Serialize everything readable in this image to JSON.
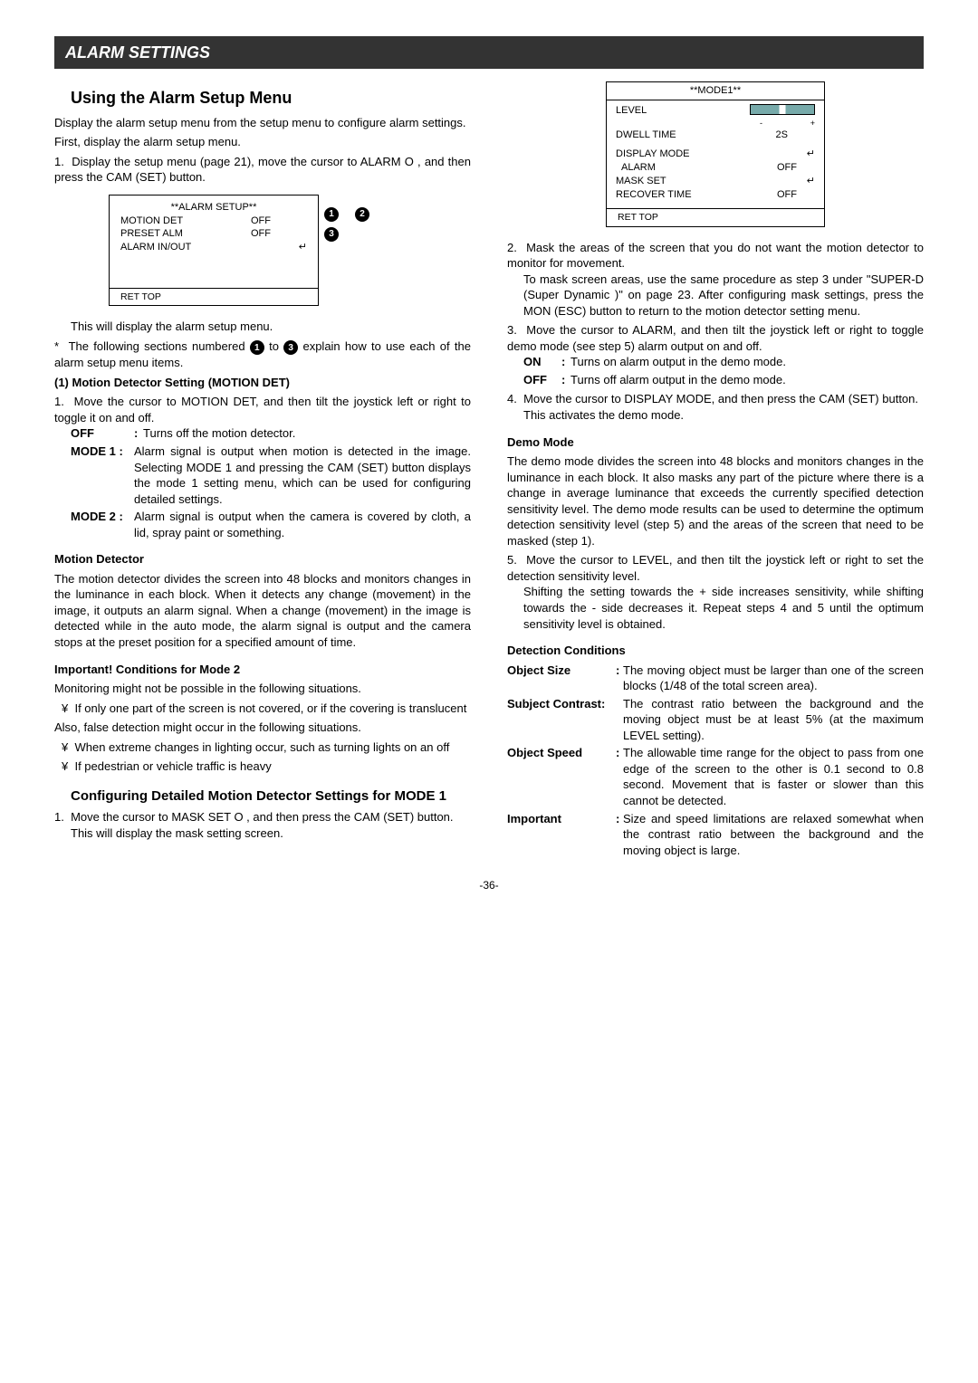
{
  "titleBar": "ALARM SETTINGS",
  "leftCol": {
    "h2": "Using the Alarm Setup Menu",
    "intro1": "Display the alarm setup menu from the setup menu to configure alarm settings.",
    "intro2": "First, display the alarm setup menu.",
    "step1": "Display the setup menu (page 21), move the cursor to ALARM O , and then press the CAM (SET) button.",
    "osd1": {
      "title": "**ALARM SETUP**",
      "r1a": "MOTION DET",
      "r1b": "OFF",
      "r2a": "PRESET ALM",
      "r2b": "OFF",
      "r3a": "ALARM IN/OUT",
      "arrow": "↵",
      "footer": "RET TOP"
    },
    "afterOsd1": "This will display the alarm setup menu.",
    "note": "The following sections numbered",
    "noteTo": "to",
    "noteEnd": "explain how to use each of the alarm setup menu items.",
    "h_section1": "(1)  Motion Detector Setting (MOTION DET)",
    "md_step1": "Move the cursor to MOTION DET, and then tilt the joystick left or right to toggle it on and off.",
    "off_label": "OFF",
    "off_colon": ":",
    "off_body": "Turns off the motion detector.",
    "mode1_label": "MODE 1 :",
    "mode1_body": "Alarm signal is output when motion is detected in the image. Selecting MODE 1 and pressing the CAM (SET) button displays the mode 1 setting menu, which can be used for configuring detailed settings.",
    "mode2_label": "MODE 2 :",
    "mode2_body": "Alarm signal is output when the camera is covered by cloth, a lid, spray paint or something.",
    "h_md": "Motion Detector",
    "md_body": "The motion detector divides the screen into 48 blocks and monitors changes in the luminance in each block. When it detects any change (movement) in the image, it outputs an alarm signal. When a change (movement) in the image is detected while in the auto mode, the alarm signal is output and the camera stops at the preset position for a specified amount of time.",
    "h_imp2": "Important! Conditions for Mode 2",
    "imp2_intro": "Monitoring might not be possible in the following situations.",
    "imp2_b1": "If only one part of the screen is not covered, or if the covering is translucent",
    "imp2_mid": "Also, false detection might occur in the following situations.",
    "imp2_b2": "When extreme changes in lighting occur, such as turning lights on an off",
    "imp2_b3": "If pedestrian or vehicle traffic is heavy",
    "h_conf": "Configuring Detailed Motion Detector Settings for MODE 1",
    "conf_step1a": "Move the cursor to MASK SET O , and then press the CAM (SET) button.",
    "conf_step1b": "This will display the mask setting screen."
  },
  "rightCol": {
    "osd2": {
      "title": "**MODE1**",
      "r1a": "LEVEL",
      "r_minus": "-",
      "r_plus": "+",
      "r2a": "DWELL TIME",
      "r2b": "2S",
      "r3a": "DISPLAY MODE",
      "arrow": "↵",
      "r4a": "ALARM",
      "r4b": "OFF",
      "r5a": "MASK SET",
      "arrow2": "↵",
      "r6a": "RECOVER TIME",
      "r6b": "OFF",
      "footer": "RET TOP"
    },
    "step2": "Mask the areas of the screen that you do not want the motion detector to monitor for movement.",
    "step2b": "To mask screen areas, use the same procedure as step 3 under \"SUPER-D    (Super Dynamic    )\" on page 23. After configuring mask settings, press the MON (ESC) button to return to the motion detector setting menu.",
    "step3": "Move the cursor to ALARM, and then tilt the joystick left or right to toggle demo mode (see step 5) alarm output on and off.",
    "on_label": "ON",
    "on_body": "Turns on alarm output in the demo mode.",
    "off_label": "OFF",
    "off_body": "Turns off alarm output in the demo mode.",
    "step4": "Move the cursor to DISPLAY MODE, and then press the CAM (SET) button.",
    "step4b": "This activates the demo mode.",
    "h_demo": "Demo Mode",
    "demo_body": "The demo mode divides the screen into 48 blocks and monitors changes in the luminance in each block. It also masks any part of the picture where there is a change in average luminance that exceeds the currently specified detection sensitivity level. The demo mode results can be used to determine the optimum detection sensitivity level (step 5) and the areas of the screen that need to be masked (step 1).",
    "step5": "Move the cursor to LEVEL, and then tilt the joystick left or right to set the detection sensitivity level.",
    "step5b": "Shifting the setting towards the + side increases sensitivity, while shifting towards the - side decreases it. Repeat steps 4 and 5 until the optimum sensitivity level is obtained.",
    "h_dc": "Detection Conditions",
    "dc1_term": "Object Size",
    "dc1_body": "The moving object must be larger than one of the screen blocks (1/48 of the total screen area).",
    "dc2_term": "Subject Contrast:",
    "dc2_body": "The contrast ratio between the background and the moving object must be at least 5% (at the maximum LEVEL setting).",
    "dc3_term": "Object Speed",
    "dc3_body": "The allowable time range for the object to pass from one edge of the screen to the other is 0.1 second to 0.8 second. Movement that is faster or slower than this cannot be detected.",
    "dc4_term": "Important",
    "dc4_body": "Size and speed limitations are relaxed somewhat when the contrast ratio between the background and the moving object is large."
  },
  "pageNum": "-36-"
}
